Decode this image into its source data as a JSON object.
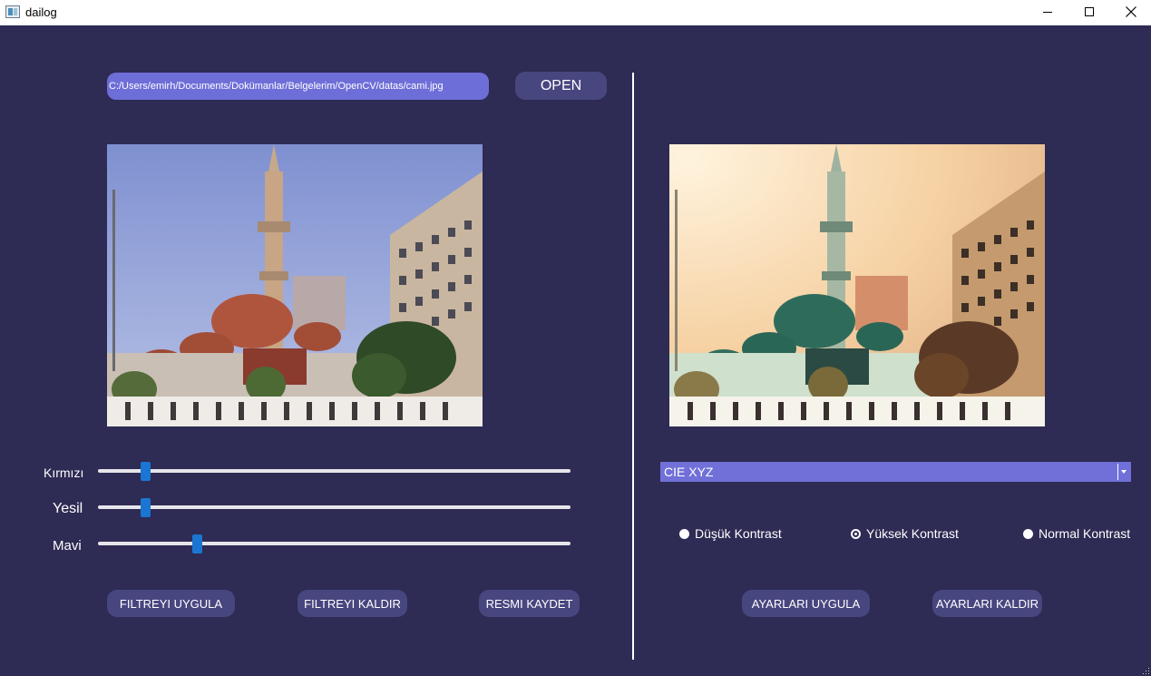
{
  "window": {
    "title": "dailog"
  },
  "file": {
    "path": "C:/Users/emirh/Documents/Dokümanlar/Belgelerim/OpenCV/datas/cami.jpg",
    "open_label": "OPEN"
  },
  "sliders": [
    {
      "label": "Kırmızı",
      "value": 0.09
    },
    {
      "label": "Yesil",
      "value": 0.09
    },
    {
      "label": "Mavi",
      "value": 0.2
    }
  ],
  "left_buttons": {
    "apply_filter": "FILTREYI UYGULA",
    "remove_filter": "FILTREYI KALDIR",
    "save_image": "RESMI KAYDET"
  },
  "colorspace": {
    "selected": "CIE XYZ"
  },
  "contrast": {
    "options": [
      "Düşük Kontrast",
      "Yüksek Kontrast",
      "Normal Kontrast"
    ],
    "selected_index": 1
  },
  "right_buttons": {
    "apply_settings": "AYARLARI UYGULA",
    "remove_settings": "AYARLARI KALDIR"
  },
  "colors": {
    "background": "#2e2b54",
    "path_field": "#6e6ed8",
    "button": "#48467f",
    "slider_handle": "#1a76d2",
    "combo": "#7070d8"
  }
}
